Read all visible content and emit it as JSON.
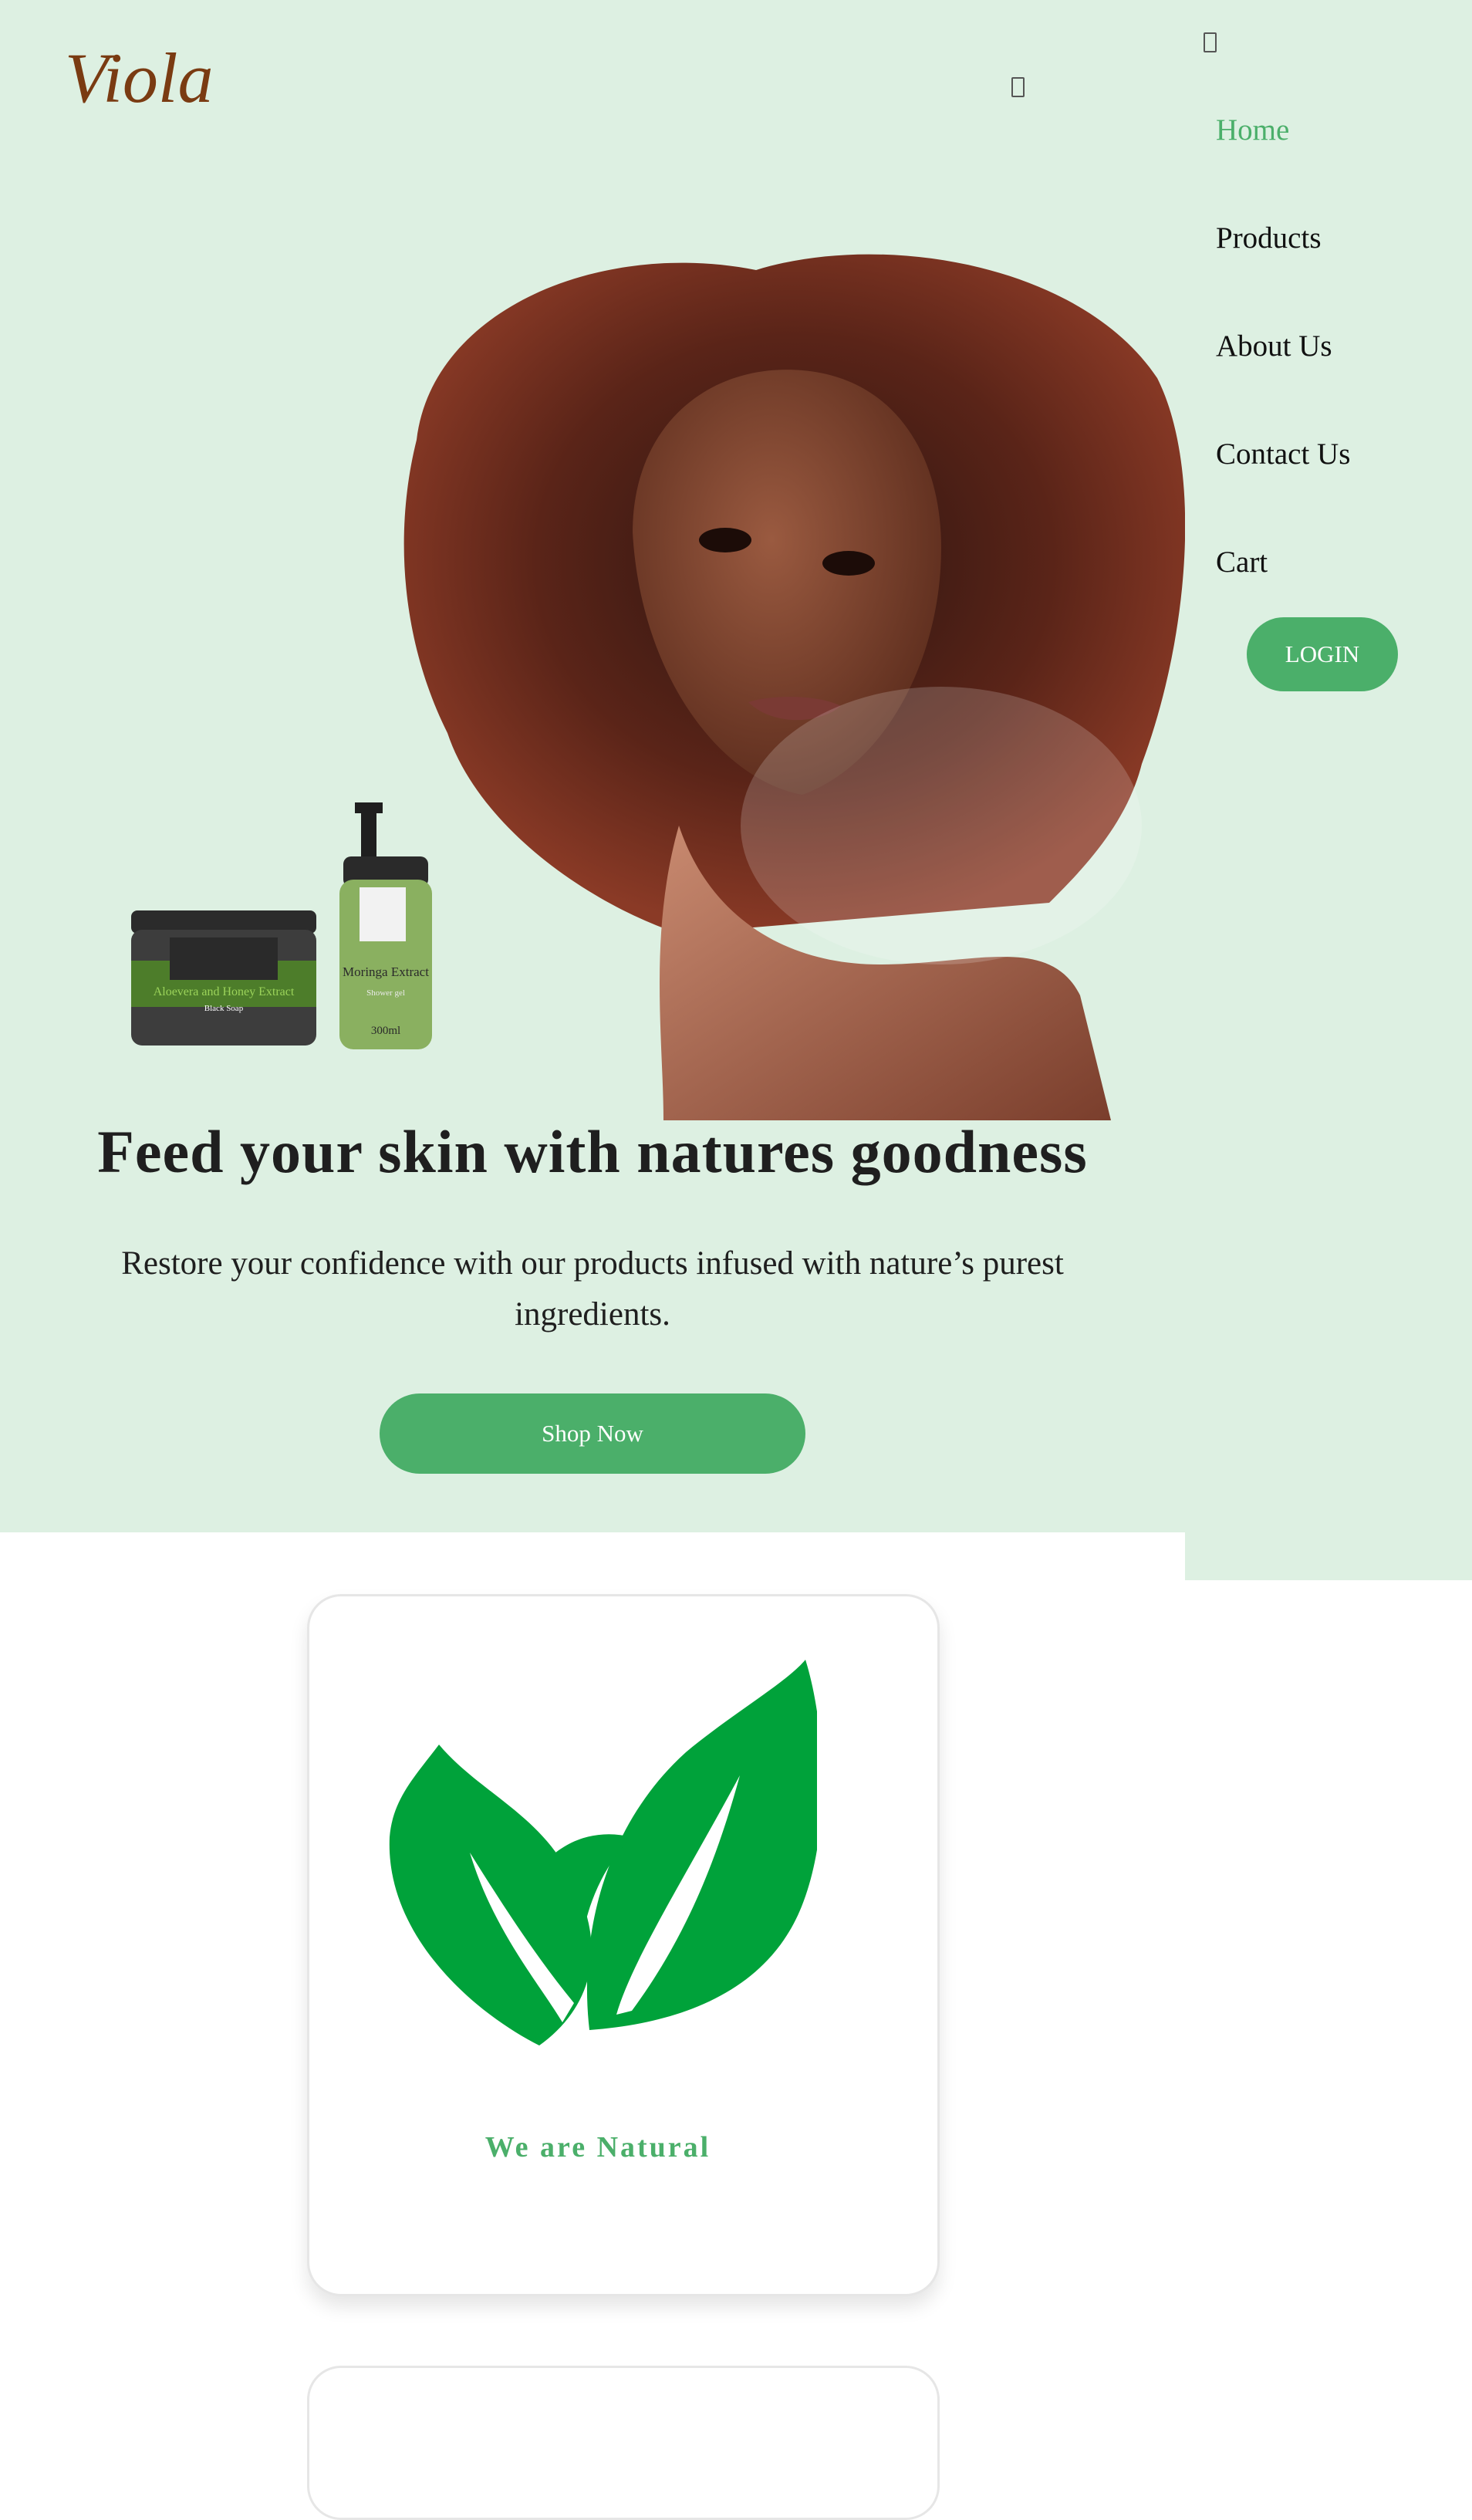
{
  "brand": {
    "logo_text": "Viola"
  },
  "header": {
    "menu_toggle_icon": "hamburger-icon"
  },
  "hero": {
    "title": "Feed your skin with natures goodness",
    "subtitle": "Restore your confidence with our products infused with nature’s purest ingredients.",
    "cta_label": "Shop Now",
    "product_jar_label": "Aloevera and Honey Extract",
    "product_jar_sublabel": "Black Soap",
    "product_bottle_label": "Moringa Extract",
    "product_bottle_sublabel": "Shower gel",
    "product_bottle_volume": "300ml"
  },
  "nav": {
    "close_icon": "close-icon",
    "items": [
      {
        "label": "Home",
        "active": true
      },
      {
        "label": "Products",
        "active": false
      },
      {
        "label": "About Us",
        "active": false
      },
      {
        "label": "Contact Us",
        "active": false
      },
      {
        "label": "Cart",
        "active": false
      }
    ],
    "login_label": "LOGIN"
  },
  "features": [
    {
      "icon": "leaf-icon",
      "title": "We are Natural"
    }
  ],
  "colors": {
    "hero_background": "#ddf0e2",
    "accent": "#4baf6a",
    "leaf": "#00a23a",
    "logo": "#7a3b12"
  }
}
